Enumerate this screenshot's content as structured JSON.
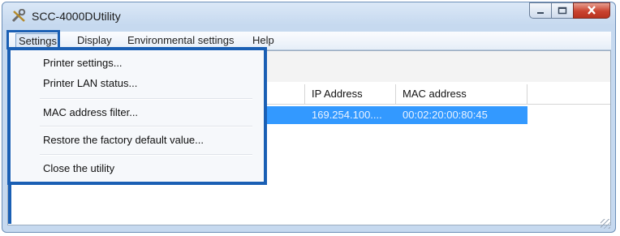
{
  "window": {
    "title": "SCC-4000DUtility"
  },
  "menubar": {
    "items": [
      {
        "label": "Settings"
      },
      {
        "label": "Display"
      },
      {
        "label": "Environmental settings"
      },
      {
        "label": "Help"
      }
    ]
  },
  "settings_menu": {
    "items": [
      {
        "label": "Printer settings..."
      },
      {
        "label": "Printer LAN status..."
      },
      {
        "label": "MAC address filter..."
      },
      {
        "label": "Restore the factory default value..."
      },
      {
        "label": "Close the utility"
      }
    ]
  },
  "table": {
    "columns": [
      "",
      "IP Address",
      "MAC address"
    ],
    "rows": [
      {
        "ip": "169.254.100....",
        "mac": "00:02:20:00:80:45"
      }
    ]
  },
  "colors": {
    "highlight": "#1a5fb4",
    "selection": "#3399ff"
  },
  "icons": {
    "app": "tools-icon",
    "minimize": "minimize-icon",
    "maximize": "maximize-icon",
    "close": "close-icon"
  }
}
